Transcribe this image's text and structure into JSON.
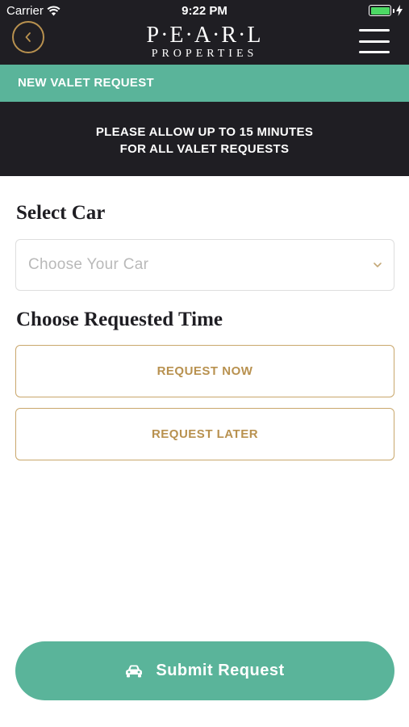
{
  "status_bar": {
    "carrier": "Carrier",
    "time": "9:22 PM"
  },
  "header": {
    "logo_main": "P·E·A·R·L",
    "logo_sub": "PROPERTIES"
  },
  "section_title": "NEW VALET REQUEST",
  "notice": {
    "line1": "PLEASE ALLOW UP TO 15 MINUTES",
    "line2": "FOR ALL VALET REQUESTS"
  },
  "select_car": {
    "label": "Select Car",
    "placeholder": "Choose Your Car"
  },
  "time_section": {
    "label": "Choose Requested Time",
    "request_now": "REQUEST NOW",
    "request_later": "REQUEST LATER"
  },
  "submit_label": "Submit Request",
  "colors": {
    "header_bg": "#1f1e23",
    "accent_green": "#5ab49a",
    "gold": "#b8914f",
    "battery": "#4cd964"
  }
}
